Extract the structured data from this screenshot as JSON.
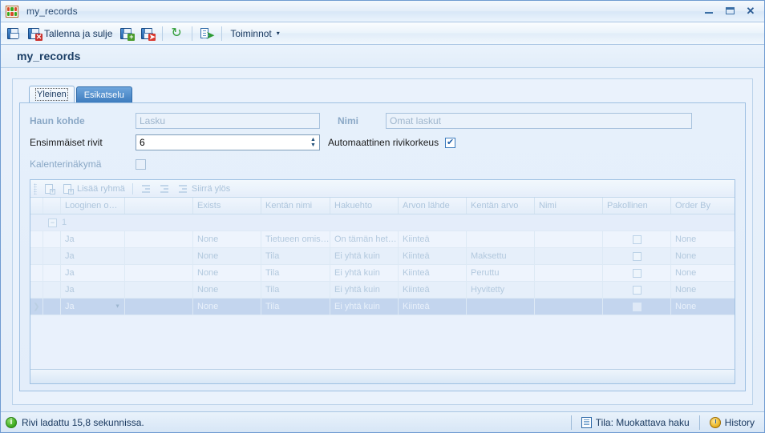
{
  "window": {
    "title": "my_records",
    "app_icon": "grid-table-icon",
    "minimize_label": "–",
    "maximize_label": "▭",
    "close_label": "✕"
  },
  "toolbar": {
    "items": [
      {
        "name": "save",
        "icon": "floppy-save-icon",
        "label": ""
      },
      {
        "name": "save-and-close",
        "icon": "floppy-close-icon",
        "label": "Tallenna ja sulje"
      },
      {
        "name": "save-and-new",
        "icon": "floppy-new-icon",
        "label": ""
      },
      {
        "name": "save-and-export",
        "icon": "floppy-export-icon",
        "label": ""
      },
      {
        "name": "refresh",
        "icon": "refresh-icon",
        "label": ""
      },
      {
        "name": "export",
        "icon": "export-icon",
        "label": ""
      },
      {
        "name": "actions",
        "icon": "chevron-down-icon",
        "label": "Toiminnot"
      }
    ],
    "actions_caret": "▾"
  },
  "page": {
    "title": "my_records"
  },
  "tabs": [
    {
      "label": "Yleinen",
      "active": true
    },
    {
      "label": "Esikatselu",
      "active": false
    }
  ],
  "form": {
    "haun_kohde": {
      "label": "Haun kohde",
      "value": "Lasku"
    },
    "nimi": {
      "label": "Nimi",
      "value": "Omat laskut"
    },
    "ensimmaiset_rivit": {
      "label": "Ensimmäiset rivit",
      "value": "6"
    },
    "automaattinen_rivikorkeus": {
      "label": "Automaattinen rivikorkeus",
      "checked": true
    },
    "kalenterinakyma": {
      "label": "Kalenterinäkymä",
      "checked": false
    }
  },
  "grid_toolbar": {
    "items": [
      {
        "name": "add-row",
        "icon": "add-row-icon",
        "label": ""
      },
      {
        "name": "add-group",
        "icon": "add-group-icon",
        "label": "Lisää ryhmä"
      },
      {
        "name": "outdent",
        "icon": "outdent-icon",
        "label": ""
      },
      {
        "name": "indent",
        "icon": "indent-icon",
        "label": ""
      },
      {
        "name": "move-up",
        "icon": "move-up-icon",
        "label": "Siirrä ylös"
      }
    ]
  },
  "grid": {
    "columns": [
      "Looginen o…",
      "",
      "Exists",
      "Kentän nimi",
      "Hakuehto",
      "Arvon lähde",
      "Kentän arvo",
      "Nimi",
      "Pakollinen",
      "Order By"
    ],
    "group_row": {
      "expander": "−",
      "label": "1"
    },
    "rows": [
      {
        "selected": false,
        "indicator": "",
        "cells": [
          "Ja",
          "",
          "None",
          "Tietueen omis…",
          "On tämän het…",
          "Kiinteä",
          "",
          "",
          "",
          "None"
        ],
        "checkbox": false
      },
      {
        "selected": false,
        "indicator": "",
        "cells": [
          "Ja",
          "",
          "None",
          "Tila",
          "Ei yhtä kuin",
          "Kiinteä",
          "Maksettu",
          "",
          "",
          "None"
        ],
        "checkbox": false
      },
      {
        "selected": false,
        "indicator": "",
        "cells": [
          "Ja",
          "",
          "None",
          "Tila",
          "Ei yhtä kuin",
          "Kiinteä",
          "Peruttu",
          "",
          "",
          "None"
        ],
        "checkbox": false
      },
      {
        "selected": false,
        "indicator": "",
        "cells": [
          "Ja",
          "",
          "None",
          "Tila",
          "Ei yhtä kuin",
          "Kiinteä",
          "Hyvitetty",
          "",
          "",
          "None"
        ],
        "checkbox": false
      },
      {
        "selected": true,
        "indicator": "❯",
        "cells": [
          "Ja",
          "",
          "None",
          "Tila",
          "Ei yhtä kuin",
          "Kiinteä",
          "",
          "",
          "",
          "None"
        ],
        "checkbox": false
      }
    ]
  },
  "statusbar": {
    "message": "Rivi ladattu 15,8 sekunnissa.",
    "info_icon": "info-icon",
    "status": {
      "label": "Tila: Muokattava haku",
      "icon": "document-icon"
    },
    "history": {
      "label": "History",
      "icon": "history-icon"
    }
  }
}
